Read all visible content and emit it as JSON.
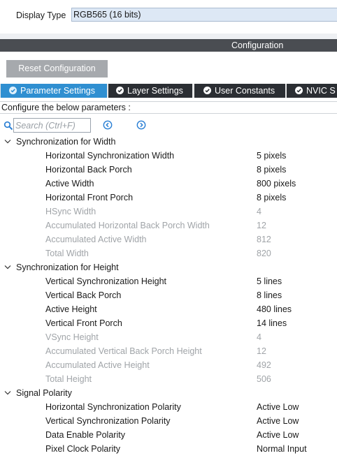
{
  "display": {
    "label": "Display Type",
    "value": "RGB565 (16 bits)"
  },
  "configuration_title": "Configuration",
  "reset_button_label": "Reset Configuration",
  "tabs": [
    {
      "label": "Parameter Settings",
      "active": true
    },
    {
      "label": "Layer Settings",
      "active": false
    },
    {
      "label": "User Constants",
      "active": false
    },
    {
      "label": "NVIC S",
      "active": false
    }
  ],
  "configure_note": "Configure the below parameters :",
  "search": {
    "placeholder": "Search (Ctrl+F)",
    "value": ""
  },
  "groups": [
    {
      "label": "Synchronization for Width",
      "params": [
        {
          "name": "Horizontal Synchronization Width",
          "value": "5 pixels",
          "enabled": true
        },
        {
          "name": "Horizontal Back Porch",
          "value": "8 pixels",
          "enabled": true
        },
        {
          "name": "Active Width",
          "value": "800 pixels",
          "enabled": true
        },
        {
          "name": "Horizontal Front Porch",
          "value": "8 pixels",
          "enabled": true
        },
        {
          "name": "HSync Width",
          "value": "4",
          "enabled": false
        },
        {
          "name": "Accumulated Horizontal Back Porch Width",
          "value": "12",
          "enabled": false
        },
        {
          "name": "Accumulated Active Width",
          "value": "812",
          "enabled": false
        },
        {
          "name": "Total Width",
          "value": "820",
          "enabled": false
        }
      ]
    },
    {
      "label": "Synchronization for Height",
      "params": [
        {
          "name": "Vertical Synchronization Height",
          "value": "5 lines",
          "enabled": true
        },
        {
          "name": "Vertical Back Porch",
          "value": "8 lines",
          "enabled": true
        },
        {
          "name": "Active Height",
          "value": "480 lines",
          "enabled": true
        },
        {
          "name": "Vertical Front Porch",
          "value": "14 lines",
          "enabled": true
        },
        {
          "name": "VSync Height",
          "value": "4",
          "enabled": false
        },
        {
          "name": "Accumulated Vertical Back Porch Height",
          "value": "12",
          "enabled": false
        },
        {
          "name": "Accumulated Active Height",
          "value": "492",
          "enabled": false
        },
        {
          "name": "Total Height",
          "value": "506",
          "enabled": false
        }
      ]
    },
    {
      "label": "Signal Polarity",
      "params": [
        {
          "name": "Horizontal Synchronization Polarity",
          "value": "Active Low",
          "enabled": true
        },
        {
          "name": "Vertical Synchronization Polarity",
          "value": "Active Low",
          "enabled": true
        },
        {
          "name": "Data Enable Polarity",
          "value": "Active Low",
          "enabled": true
        },
        {
          "name": "Pixel Clock Polarity",
          "value": "Normal Input",
          "enabled": true
        }
      ]
    }
  ],
  "colors": {
    "active_tab": "#2f8fd1",
    "inactive_tab": "#2b2e33",
    "config_bar": "#4a4d52",
    "reset_button": "#a6a9ad",
    "disabled_text": "#a0a4a8",
    "icon_blue": "#2a7fd4"
  },
  "icons": {
    "tab_check": "check-circle-icon",
    "search": "search-icon",
    "prev": "chevron-left-circle-icon",
    "next": "chevron-right-circle-icon",
    "group_toggle": "caret-down-icon"
  }
}
